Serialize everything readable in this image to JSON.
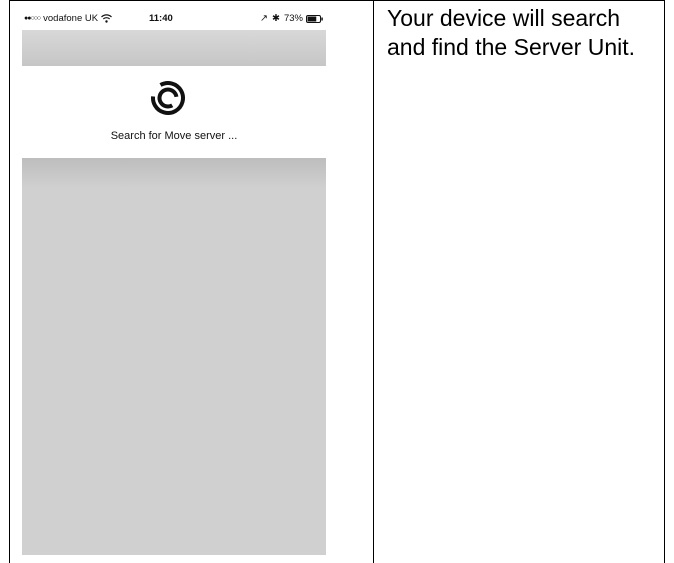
{
  "status_bar": {
    "signal": "●●○○○",
    "carrier": "vodafone UK",
    "wifi_icon": "wifi-icon",
    "time": "11:40",
    "location_icon": "location-arrow-icon",
    "location_glyph": "↗",
    "bluetooth_icon": "bluetooth-icon",
    "bluetooth_glyph": "✱",
    "battery_percent": "73%",
    "battery_level": 0.73
  },
  "search": {
    "spinner_icon": "spinner-icon",
    "label": "Search for Move server ..."
  },
  "instruction": {
    "text": "Your device will search and find the Server Unit."
  }
}
